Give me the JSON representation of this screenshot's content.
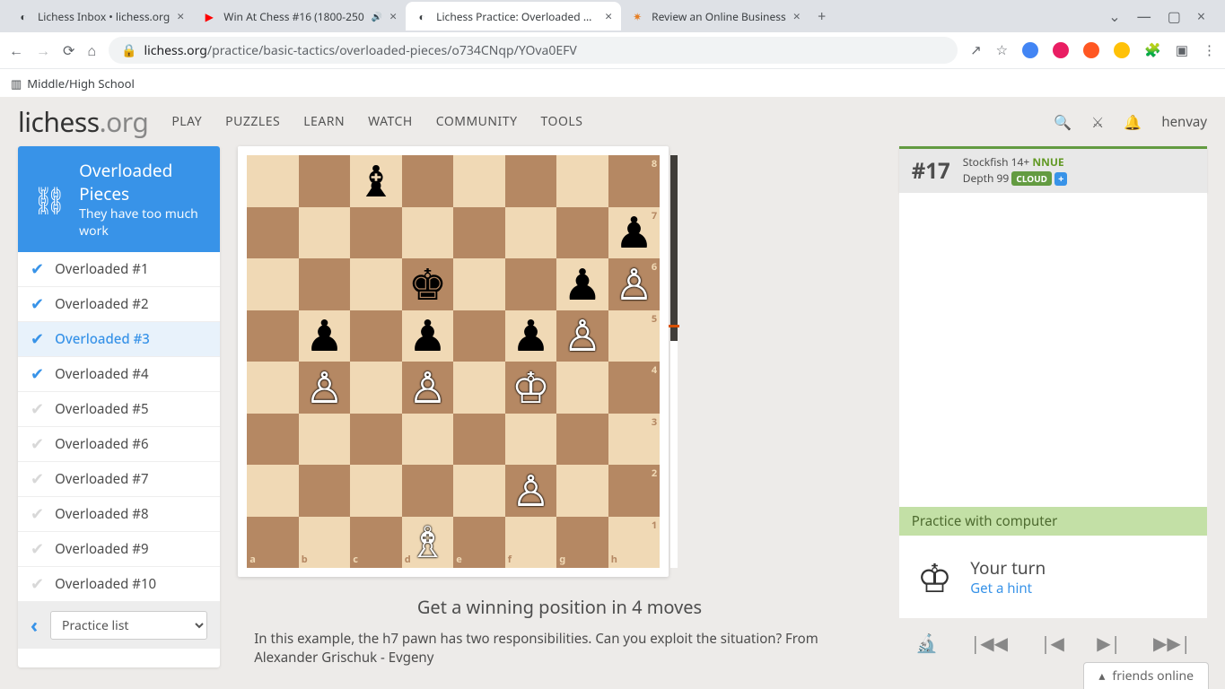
{
  "browser": {
    "tabs": [
      {
        "title": "Lichess Inbox • lichess.org",
        "favicon": "◐"
      },
      {
        "title": "Win At Chess #16 (1800-250",
        "favicon": "▶",
        "audio": true
      },
      {
        "title": "Lichess Practice: Overloaded Pie",
        "favicon": "◐",
        "active": true
      },
      {
        "title": "Review an Online Business",
        "favicon": "✷"
      }
    ],
    "url_host": "lichess.org",
    "url_path": "/practice/basic-tactics/overloaded-pieces/o734CNqp/YOva0EFV",
    "bookmark": "Middle/High School"
  },
  "site": {
    "logo_main": "lichess",
    "logo_suffix": ".org",
    "menu": [
      "PLAY",
      "PUZZLES",
      "LEARN",
      "WATCH",
      "COMMUNITY",
      "TOOLS"
    ],
    "username": "henvay"
  },
  "sidebar": {
    "title": "Overloaded Pieces",
    "subtitle": "They have too much work",
    "items": [
      {
        "label": "Overloaded #1",
        "done": true
      },
      {
        "label": "Overloaded #2",
        "done": true
      },
      {
        "label": "Overloaded #3",
        "done": true,
        "active": true
      },
      {
        "label": "Overloaded #4",
        "done": true
      },
      {
        "label": "Overloaded #5",
        "done": false
      },
      {
        "label": "Overloaded #6",
        "done": false
      },
      {
        "label": "Overloaded #7",
        "done": false
      },
      {
        "label": "Overloaded #8",
        "done": false
      },
      {
        "label": "Overloaded #9",
        "done": false
      },
      {
        "label": "Overloaded #10",
        "done": false
      }
    ],
    "select_label": "Practice list"
  },
  "board": {
    "fen_pieces": {
      "c8": "bB",
      "h7": "bP",
      "g6": "bP",
      "h6": "wP",
      "d6": "bK",
      "b5": "bP",
      "d5": "bP",
      "f5": "bP",
      "g5": "wP",
      "b4": "wP",
      "d4": "wP",
      "f4": "wK",
      "f2": "wP",
      "d1": "wB"
    },
    "files": [
      "a",
      "b",
      "c",
      "d",
      "e",
      "f",
      "g",
      "h"
    ],
    "ranks": [
      "8",
      "7",
      "6",
      "5",
      "4",
      "3",
      "2",
      "1"
    ],
    "goal": "Get a winning position in 4 moves",
    "desc": "In this example, the h7 pawn has two responsibilities. Can you exploit the situation? From Alexander Grischuk - Evgeny"
  },
  "analysis": {
    "eval": "#17",
    "engine": "Stockfish 14+",
    "nnue": "NNUE",
    "depth_label": "Depth 99",
    "cloud": "CLOUD",
    "practice_label": "Practice with computer",
    "turn": "Your turn",
    "hint": "Get a hint"
  },
  "friends": "friends online"
}
